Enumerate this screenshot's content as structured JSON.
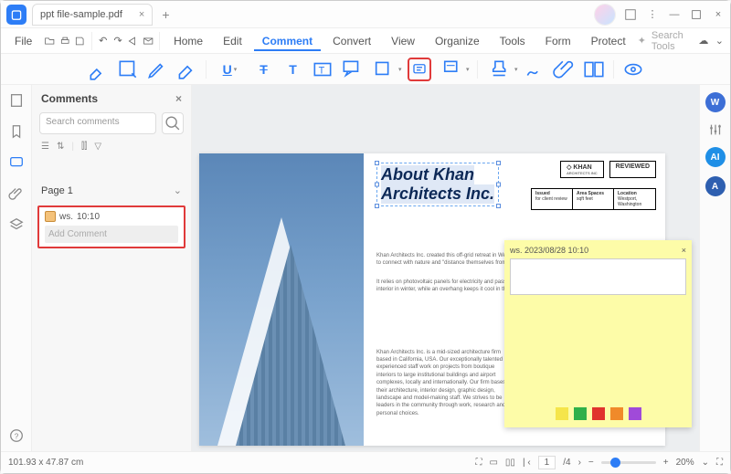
{
  "titlebar": {
    "tab_title": "ppt file-sample.pdf"
  },
  "menubar": {
    "file": "File",
    "items": [
      "Home",
      "Edit",
      "Comment",
      "Convert",
      "View",
      "Organize",
      "Tools",
      "Form",
      "Protect"
    ],
    "active_index": 2,
    "search_placeholder": "Search Tools"
  },
  "comments": {
    "title": "Comments",
    "search_placeholder": "Search comments",
    "page_label": "Page 1",
    "entry": {
      "author": "ws.",
      "time": "10:10",
      "input_placeholder": "Add Comment"
    }
  },
  "document": {
    "heading_line1": "About Khan",
    "heading_line2": "Architects Inc.",
    "brand_name": "KHAN",
    "brand_sub": "ARCHITECTS INC",
    "reviewed": "REVIEWED",
    "info": [
      {
        "label": "Issued",
        "value": "for client review"
      },
      {
        "label": "Area Spaces",
        "value": "sqft feet"
      },
      {
        "label": "Location",
        "value": "Westport, Washington"
      }
    ],
    "para1": "Khan Architects Inc. created this off-grid retreat in Westport, Washington for a family looking for an isolated place to connect with nature and \"distance themselves from social stresses.\"",
    "para2": "It relies on photovoltaic panels for electricity and passive building techniques that bring sunlight in to warm the interior in winter, while an overhang keeps it cool in the summer.",
    "para3": "Khan Architects Inc. is a mid-sized architecture firm based in California, USA. Our exceptionally talented and experienced staff work on projects from boutique interiors to large institutional buildings and airport complexes, locally and internationally. Our firm bases their architecture, interior design, graphic design, landscape and model-making staff. We strives to be leaders in the community through work, research and personal choices."
  },
  "sticky": {
    "author": "ws.",
    "timestamp": "2023/08/28 10:10",
    "colors": [
      "#f5e54a",
      "#2fb04a",
      "#e0332d",
      "#f08a2a",
      "#a04ad9"
    ]
  },
  "ai_badges": {
    "w": "W",
    "ai": "AI",
    "a": "A"
  },
  "statusbar": {
    "dims": "101.93 x 47.87 cm",
    "page_current": "1",
    "page_sep": "/4",
    "zoom": "20%"
  }
}
